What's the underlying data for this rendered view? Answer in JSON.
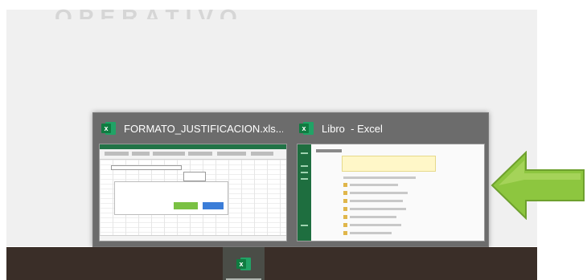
{
  "colors": {
    "accent_excel": "#107c41",
    "arrow": "#8dc63f",
    "panel": "#6c6c6c",
    "taskbar": "#3a2e28"
  },
  "banner_text": "OPERATIVO",
  "thumbnails": [
    {
      "title": "FORMATO_JUSTIFICACION.xls...",
      "icon": "excel-icon",
      "icon_letter": "x"
    },
    {
      "title": "Libro  - Excel",
      "icon": "excel-icon",
      "icon_letter": "x"
    }
  ],
  "taskbar": {
    "active_app_icon": "excel-icon",
    "icon_letter": "x"
  },
  "annotation": {
    "icon": "left-arrow-icon"
  }
}
